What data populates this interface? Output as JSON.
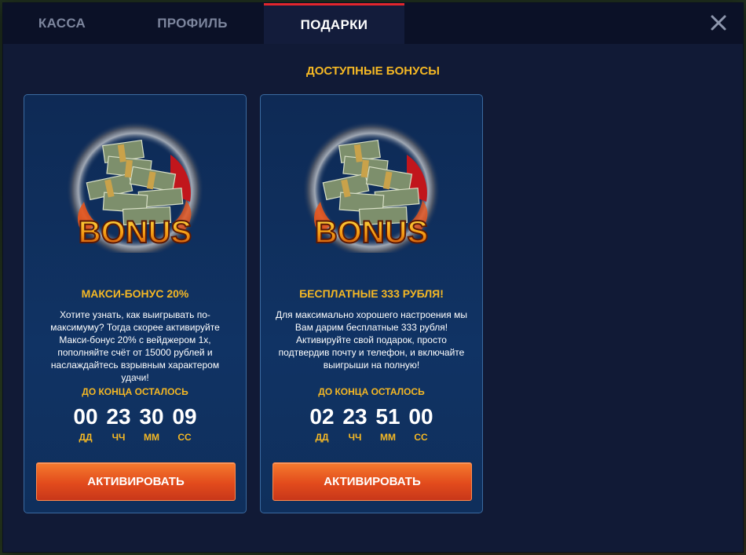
{
  "tabs": [
    {
      "label": "КАССА",
      "active": false
    },
    {
      "label": "ПРОФИЛЬ",
      "active": false
    },
    {
      "label": "ПОДАРКИ",
      "active": true
    }
  ],
  "close_icon": "close-icon",
  "section_title": "ДОСТУПНЫЕ БОНУСЫ",
  "colors": {
    "accent": "#f5b824",
    "button": "#e24b1c",
    "modal": "#111a36",
    "tab_active_border": "#e1262d"
  },
  "cards": [
    {
      "image": "bonus-money-icon",
      "image_text": "BONUS",
      "title": "МАКСИ-БОНУС 20%",
      "description": "Хотите узнать, как выигрывать по-максимуму? Тогда скорее активируйте Макси-бонус 20% с вейджером 1х, пополняйте счёт от 15000 рублей и наслаждайтесь взрывным характером удачи!",
      "timer_label": "ДО КОНЦА ОСТАЛОСЬ",
      "timer": {
        "dd": "00",
        "hh": "23",
        "mm": "30",
        "ss": "09"
      },
      "units": {
        "dd": "ДД",
        "hh": "ЧЧ",
        "mm": "ММ",
        "ss": "СС"
      },
      "button": "АКТИВИРОВАТЬ"
    },
    {
      "image": "bonus-money-icon",
      "image_text": "BONUS",
      "title": "БЕСПЛАТНЫЕ 333 РУБЛЯ!",
      "description": "Для максимально хорошего настроения мы Вам дарим бесплатные 333 рубля! Активируйте свой подарок, просто подтвердив почту и телефон, и включайте выигрыши на полную!",
      "timer_label": "ДО КОНЦА ОСТАЛОСЬ",
      "timer": {
        "dd": "02",
        "hh": "23",
        "mm": "51",
        "ss": "00"
      },
      "units": {
        "dd": "ДД",
        "hh": "ЧЧ",
        "mm": "ММ",
        "ss": "СС"
      },
      "button": "АКТИВИРОВАТЬ"
    }
  ]
}
